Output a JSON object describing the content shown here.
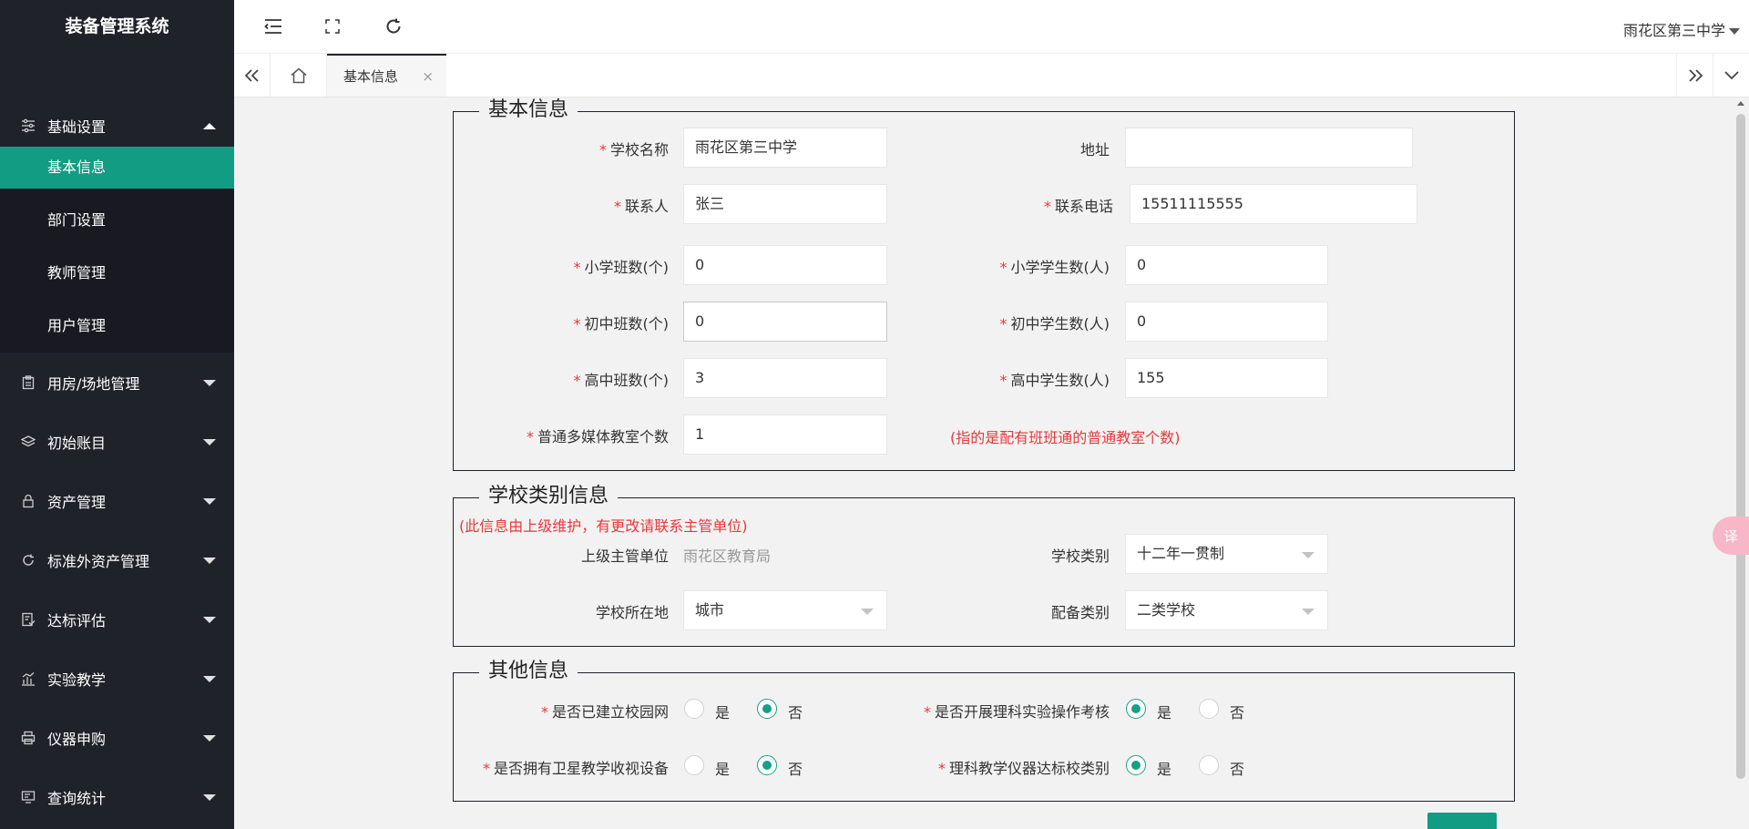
{
  "app": {
    "title": "装备管理系统"
  },
  "header": {
    "school_name": "雨花区第三中学"
  },
  "sidebar": {
    "basic": {
      "label": "基础设置",
      "items": [
        "基本信息",
        "部门设置",
        "教师管理",
        "用户管理"
      ]
    },
    "menus": [
      {
        "label": "用房/场地管理",
        "icon": "clipboard-icon"
      },
      {
        "label": "初始账目",
        "icon": "layers-icon"
      },
      {
        "label": "资产管理",
        "icon": "lock-icon"
      },
      {
        "label": "标准外资产管理",
        "icon": "refresh-icon"
      },
      {
        "label": "达标评估",
        "icon": "checklist-icon"
      },
      {
        "label": "实验教学",
        "icon": "chart-icon"
      },
      {
        "label": "仪器申购",
        "icon": "printer-icon"
      },
      {
        "label": "查询统计",
        "icon": "monitor-icon"
      }
    ]
  },
  "tabs": {
    "active": "基本信息",
    "close": "×"
  },
  "basic_info": {
    "legend": "基本信息",
    "school_name": {
      "label": "学校名称",
      "value": "雨花区第三中学"
    },
    "address": {
      "label": "地址",
      "value": ""
    },
    "contact": {
      "label": "联系人",
      "value": "张三"
    },
    "phone": {
      "label": "联系电话",
      "value": "15511115555"
    },
    "primary_classes": {
      "label": "小学班数(个)",
      "value": "0"
    },
    "primary_students": {
      "label": "小学学生数(人)",
      "value": "0"
    },
    "junior_classes": {
      "label": "初中班数(个)",
      "value": "0"
    },
    "junior_students": {
      "label": "初中学生数(人)",
      "value": "0"
    },
    "senior_classes": {
      "label": "高中班数(个)",
      "value": "3"
    },
    "senior_students": {
      "label": "高中学生数(人)",
      "value": "155"
    },
    "multimedia": {
      "label": "普通多媒体教室个数",
      "value": "1"
    },
    "multimedia_hint": "(指的是配有班班通的普通教室个数)"
  },
  "category_info": {
    "legend": "学校类别信息",
    "note": "(此信息由上级维护，有更改请联系主管单位)",
    "authority": {
      "label": "上级主管单位",
      "value": "雨花区教育局"
    },
    "school_type": {
      "label": "学校类别",
      "value": "十二年一贯制"
    },
    "location": {
      "label": "学校所在地",
      "value": "城市"
    },
    "equip_type": {
      "label": "配备类别",
      "value": "二类学校"
    }
  },
  "other_info": {
    "legend": "其他信息",
    "yes": "是",
    "no": "否",
    "campus_net": {
      "label": "是否已建立校园网",
      "selected": "否"
    },
    "science_exam": {
      "label": "是否开展理科实验操作考核",
      "selected": "是"
    },
    "satellite": {
      "label": "是否拥有卫星教学收视设备",
      "selected": "否"
    },
    "instrument_std": {
      "label": "理科教学仪器达标校类别",
      "selected": "是"
    }
  },
  "float_button": {
    "label": "译"
  },
  "colors": {
    "sidebar": "#20222a",
    "accent": "#139c84",
    "required": "#e4393c"
  }
}
